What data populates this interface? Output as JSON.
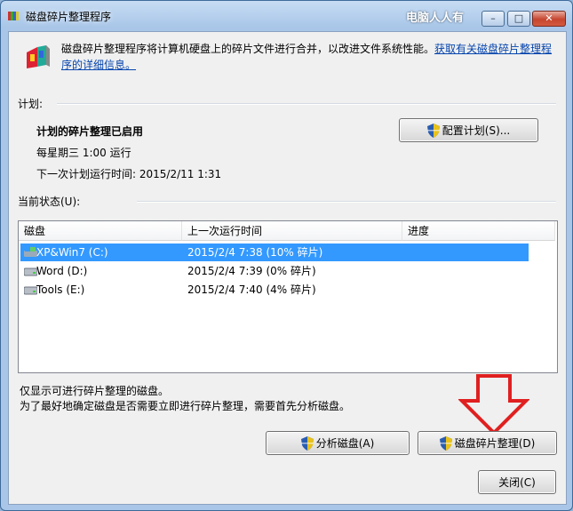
{
  "window": {
    "title": "磁盘碎片整理程序",
    "watermark": "电脑人人有"
  },
  "title_controls": {
    "minimize": "–",
    "maximize": "□",
    "close": "✕"
  },
  "intro": {
    "text": "磁盘碎片整理程序将计算机硬盘上的碎片文件进行合并，以改进文件系统性能。",
    "link": "获取有关磁盘碎片整理程序的详细信息。"
  },
  "schedule": {
    "section_label": "计划:",
    "status": "计划的碎片整理已启用",
    "frequency": "每星期三 1:00 运行",
    "next_run": "下一次计划运行时间: 2015/2/11 1:31",
    "configure_button": "配置计划(S)..."
  },
  "current_status": {
    "section_label": "当前状态(U):",
    "columns": [
      "磁盘",
      "上一次运行时间",
      "进度"
    ],
    "rows": [
      {
        "disk": "XP&Win7 (C:)",
        "last_run": "2015/2/4 7:38 (10% 碎片)",
        "progress": ""
      },
      {
        "disk": "Word (D:)",
        "last_run": "2015/2/4 7:39 (0% 碎片)",
        "progress": ""
      },
      {
        "disk": "Tools (E:)",
        "last_run": "2015/2/4 7:40 (4% 碎片)",
        "progress": ""
      }
    ],
    "selected_index": 0
  },
  "notes": {
    "line1": "仅显示可进行碎片整理的磁盘。",
    "line2": "为了最好地确定磁盘是否需要立即进行碎片整理，需要首先分析磁盘。"
  },
  "buttons": {
    "analyze": "分析磁盘(A)",
    "defragment": "磁盘碎片整理(D)",
    "close": "关闭(C)"
  },
  "colors": {
    "selection": "#3399ff",
    "link": "#0645ad",
    "annotation_arrow": "#e02020"
  }
}
